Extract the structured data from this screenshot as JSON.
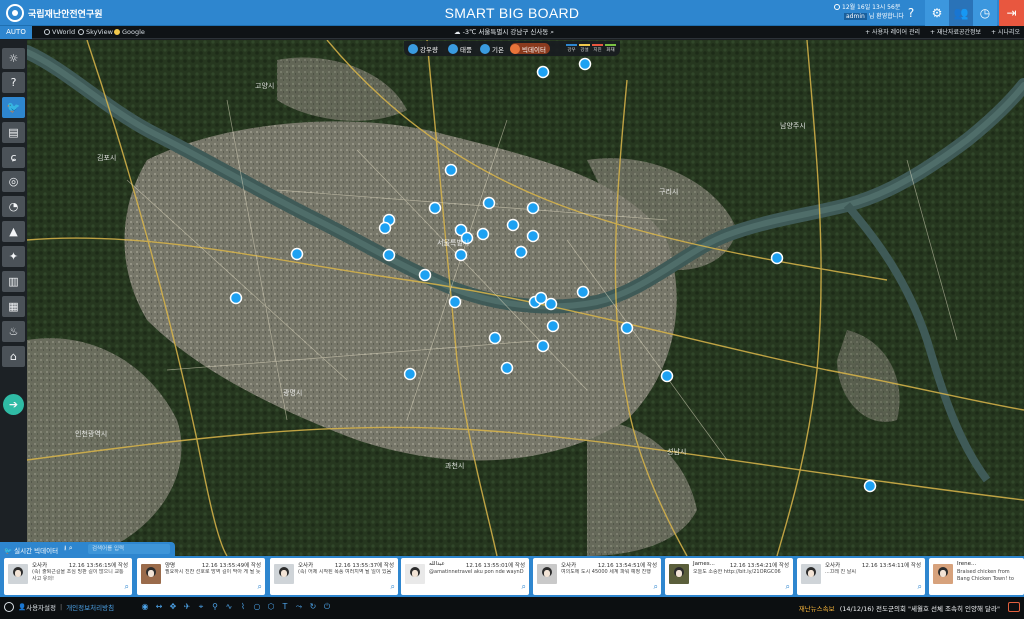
{
  "header": {
    "logo_text": "국립재난안전연구원",
    "title": "SMART BIG BOARD",
    "datetime_line1": "12월 16일 13시 56분",
    "datetime_user": "admin",
    "datetime_line2": "님 환영합니다",
    "buttons": [
      "help-icon",
      "settings-icon",
      "users-icon",
      "history-icon",
      "exit-icon"
    ]
  },
  "subbar": {
    "auto_label": "AUTO",
    "layers": [
      {
        "label": "VWorld",
        "selected": false
      },
      {
        "label": "SkyView",
        "selected": false
      },
      {
        "label": "Google",
        "selected": true
      }
    ],
    "weather": "-3℃  서울특별시 강남구 신사동",
    "links": [
      "+ 사용자 레이어 관리",
      "+ 재난자료공간정보",
      "+ 시나리오"
    ]
  },
  "categories": [
    {
      "label": "강우량"
    },
    {
      "label": "태풍"
    },
    {
      "label": "기온"
    },
    {
      "label": "빅데이터",
      "active": true
    }
  ],
  "legend_colors": [
    "#2e86cf",
    "#f2c94c",
    "#e8573f",
    "#7ac142"
  ],
  "legend_labels": [
    "강우",
    "강설",
    "지진",
    "화재"
  ],
  "left_tools": [
    "sun-icon",
    "help-icon",
    "twitter-icon",
    "news-icon",
    "typhoon-icon",
    "globe-icon",
    "chat-icon",
    "mountain-icon",
    "satellite-icon",
    "chart-icon",
    "building-icon",
    "fire-icon",
    "house-icon",
    "arrow-right-icon"
  ],
  "panel": {
    "title": "실시간 빅데이터",
    "search_placeholder": "검색어를 입력"
  },
  "feed": [
    {
      "name": "오사카",
      "time": "12.16 13:56:15에 작성",
      "text": "(속) 출퇴근길을 조심 빙판 길이 많으니 교통사고 유의!"
    },
    {
      "name": "양명",
      "time": "12.16 13:55:49에 작성",
      "text": "필요하시 진찬 선호로 방역 길이 막아 게 될 듯"
    },
    {
      "name": "오사카",
      "time": "12.16 13:55:37에 작성",
      "text": "(속) 어제 시작된 폭풍 여러지역 될 일이 있음"
    },
    {
      "name": "عبدالله",
      "time": "12.16 13:55:01에 작성",
      "text": "@amatinnetravel aku pon nde waynD"
    },
    {
      "name": "오사카",
      "time": "12.16 13:54:51에 작성",
      "text": "여의도에 도시 45000 세계 파워 예정 진행"
    },
    {
      "name": "James...",
      "time": "12.16 13:54:21에 작성",
      "text": "오늘도 소중한 http://bit.ly/21ORGC06"
    },
    {
      "name": "오사카",
      "time": "12.16 13:54:11에 작성",
      "text": "...끄레 진 날씨"
    },
    {
      "name": "Irene...",
      "time": "",
      "text": "Braised chicken from Bang Chicken Town! to Kim Di. a small restaurant together that serves only..."
    }
  ],
  "statusbar": {
    "user_label": "사용자설정",
    "privacy_label": "개인정보처리방침",
    "news_tag": "재난뉴스속보",
    "news_text": "(14/12/16) 전도군의회 \"세월호 선체 조속히 인양해 달라\""
  }
}
